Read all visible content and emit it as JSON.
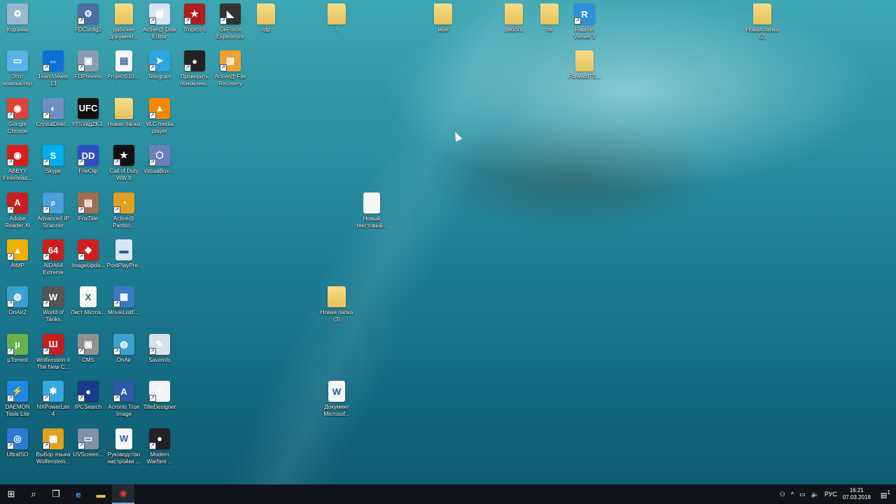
{
  "desktop": {
    "icons": [
      {
        "label": "Корзина",
        "icon": "recycle-bin",
        "color": "#9ab7d0",
        "glyph": "♻"
      },
      {
        "label": "FDConfig2",
        "icon": "fdconfig",
        "color": "#4a6fa5",
        "glyph": "⚙"
      },
      {
        "label": "рабочие документ...",
        "icon": "folder",
        "color": "#e8c25a",
        "glyph": ""
      },
      {
        "label": "Active@ Disk Editor",
        "icon": "disk-editor",
        "color": "#d8e4f0",
        "glyph": "▦"
      },
      {
        "label": "Tropico 5",
        "icon": "tropico",
        "color": "#b21e1e",
        "glyph": "★"
      },
      {
        "label": "GeForce Experience",
        "icon": "geforce",
        "color": "#333333",
        "glyph": "◣"
      },
      {
        "label": "rdp",
        "icon": "folder",
        "color": "#e8c25a",
        "glyph": ""
      },
      {
        "label": "!",
        "icon": "folder",
        "color": "#e8c25a",
        "glyph": ""
      },
      {
        "label": "мое",
        "icon": "folder",
        "color": "#e8c25a",
        "glyph": ""
      },
      {
        "label": "работа",
        "icon": "folder",
        "color": "#e8c25a",
        "glyph": ""
      },
      {
        "label": "пи",
        "icon": "folder",
        "color": "#e8c25a",
        "glyph": ""
      },
      {
        "label": "Radmin Viewer 3",
        "icon": "radmin",
        "color": "#2f8fd8",
        "glyph": "R"
      },
      {
        "label": "Новая папка (2)",
        "icon": "folder",
        "color": "#e8c25a",
        "glyph": ""
      },
      {
        "label": "Этот компьютер",
        "icon": "computer",
        "color": "#5ab0e8",
        "glyph": "▭"
      },
      {
        "label": "TeamViewer 13",
        "icon": "teamviewer",
        "color": "#0e6fd8",
        "glyph": "⇔"
      },
      {
        "label": "FDPreview",
        "icon": "fdpreview",
        "color": "#8a9bb0",
        "glyph": "▣"
      },
      {
        "label": "Project010....",
        "icon": "file",
        "color": "#f4f6f8",
        "glyph": "▤"
      },
      {
        "label": "Telegram",
        "icon": "telegram",
        "color": "#2ca5e0",
        "glyph": "➤"
      },
      {
        "label": "Проверить обновлен...",
        "icon": "cod-update",
        "color": "#222222",
        "glyph": "●"
      },
      {
        "label": "Active@ File Recovery",
        "icon": "file-recovery",
        "color": "#f0a030",
        "glyph": "▧"
      },
      {
        "label": "ForwardTS...",
        "icon": "folder",
        "color": "#e8c25a",
        "glyph": ""
      },
      {
        "label": "Google Chrome",
        "icon": "chrome",
        "color": "#db4437",
        "glyph": "◉"
      },
      {
        "label": "CrystalDiskI...",
        "icon": "crystaldisk",
        "color": "#6f8fc0",
        "glyph": "◐"
      },
      {
        "label": "YTSVagZKJ...",
        "icon": "ufc-image",
        "color": "#111111",
        "glyph": "UFC"
      },
      {
        "label": "Новая папка",
        "icon": "folder",
        "color": "#e8c25a",
        "glyph": ""
      },
      {
        "label": "VLC media player",
        "icon": "vlc",
        "color": "#f08a00",
        "glyph": "▲"
      },
      {
        "label": "ABBYY FineRead...",
        "icon": "abbyy",
        "color": "#d81e1e",
        "glyph": "◉"
      },
      {
        "label": "Skype",
        "icon": "skype",
        "color": "#00aff0",
        "glyph": "S"
      },
      {
        "label": "FrwClip",
        "icon": "frwclip",
        "color": "#3050c0",
        "glyph": "DD"
      },
      {
        "label": "Call of Duty WW II",
        "icon": "cod-ww2",
        "color": "#111111",
        "glyph": "★"
      },
      {
        "label": "VirtualBox-...",
        "icon": "virtualbox",
        "color": "#6b7fb8",
        "glyph": "⬡"
      },
      {
        "label": "Adobe Reader XI",
        "icon": "adobe-reader",
        "color": "#c81e1e",
        "glyph": "A"
      },
      {
        "label": "Advanced IP Scanner",
        "icon": "ip-scanner",
        "color": "#4aa0d8",
        "glyph": "⌕"
      },
      {
        "label": "FrwTitle",
        "icon": "frwtitle",
        "color": "#a07050",
        "glyph": "▤"
      },
      {
        "label": "Active@ Partitio...",
        "icon": "partition",
        "color": "#e0a020",
        "glyph": "◔"
      },
      {
        "label": "Новый текстовый...",
        "icon": "file",
        "color": "#f4f6f8",
        "glyph": ""
      },
      {
        "label": "AIMP",
        "icon": "aimp",
        "color": "#f0b000",
        "glyph": "▲"
      },
      {
        "label": "AIDA64 Extreme",
        "icon": "aida64",
        "color": "#c81e1e",
        "glyph": "64"
      },
      {
        "label": "ImageUpda...",
        "icon": "imageupdater",
        "color": "#d02020",
        "glyph": "◆"
      },
      {
        "label": "PostPlayPre...",
        "icon": "file",
        "color": "#d8e6f4",
        "glyph": "▬"
      },
      {
        "label": "OnAir2",
        "icon": "onair2",
        "color": "#3aa0d0",
        "glyph": "◍"
      },
      {
        "label": "World of Tanks",
        "icon": "wot",
        "color": "#555555",
        "glyph": "W"
      },
      {
        "label": "Лист Micros...",
        "icon": "excel",
        "color": "#f4f6f8",
        "glyph": "X"
      },
      {
        "label": "MovieListE...",
        "icon": "movielist",
        "color": "#3a7ac0",
        "glyph": "▦"
      },
      {
        "label": "Новая папка (3)",
        "icon": "folder",
        "color": "#e8c25a",
        "glyph": ""
      },
      {
        "label": "µTorrent",
        "icon": "utorrent",
        "color": "#6ab04c",
        "glyph": "µ"
      },
      {
        "label": "Wolfenstein II The New C...",
        "icon": "wolfenstein",
        "color": "#c81e1e",
        "glyph": "Ш"
      },
      {
        "label": "CMS",
        "icon": "cms",
        "color": "#909090",
        "glyph": "▣"
      },
      {
        "label": "OnAir",
        "icon": "onair",
        "color": "#3aa0d0",
        "glyph": "◍"
      },
      {
        "label": "SaveInfo",
        "icon": "saveinfo",
        "color": "#d8e0f0",
        "glyph": "✎"
      },
      {
        "label": "DAEMON Tools Lite",
        "icon": "daemon-tools",
        "color": "#1e88e5",
        "glyph": "⚡"
      },
      {
        "label": "NXPowerLite 4",
        "icon": "nxpowerlite",
        "color": "#3aa8e0",
        "glyph": "✱"
      },
      {
        "label": "IPCSearch",
        "icon": "ipcsearch",
        "color": "#1a3a8a",
        "glyph": "●"
      },
      {
        "label": "Acronis True Image",
        "icon": "acronis",
        "color": "#2a5aa8",
        "glyph": "A"
      },
      {
        "label": "TitleDesigner",
        "icon": "titledesigner",
        "color": "#f4f4f4",
        "glyph": "T"
      },
      {
        "label": "Документ Microsof...",
        "icon": "word",
        "color": "#f4f6f8",
        "glyph": "W"
      },
      {
        "label": "UltraISO",
        "icon": "ultraiso",
        "color": "#2a7ad0",
        "glyph": "◎"
      },
      {
        "label": "Выбор языка Wolfenstein...",
        "icon": "language",
        "color": "#e0a020",
        "glyph": "▦"
      },
      {
        "label": "UVScreen...",
        "icon": "uvscreen",
        "color": "#8090a8",
        "glyph": "▭"
      },
      {
        "label": "Руководство настройки ...",
        "icon": "word",
        "color": "#f4f6f8",
        "glyph": "W"
      },
      {
        "label": "Modern Warfare ...",
        "icon": "modern-warfare",
        "color": "#222222",
        "glyph": "●"
      }
    ]
  },
  "taskbar": {
    "start": "⊞",
    "search": "⌕",
    "task_view": "❐",
    "edge": "e",
    "explorer": "▬",
    "chrome": "◉",
    "tray": {
      "people": "⚇",
      "chevron": "^",
      "network": "▭",
      "volume": "🔈",
      "language": "РУС",
      "time": "16:21",
      "date": "07.03.2018",
      "notifications": "1"
    }
  }
}
